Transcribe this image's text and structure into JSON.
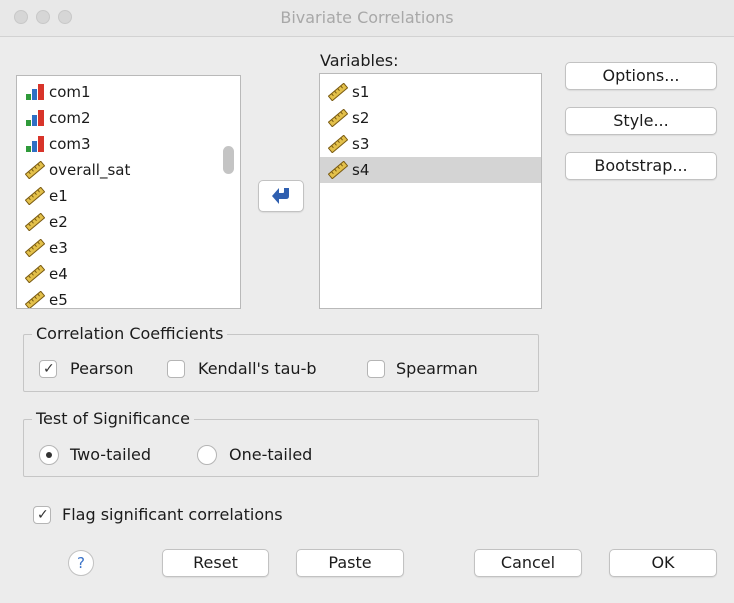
{
  "window": {
    "title": "Bivariate Correlations"
  },
  "source_list": {
    "items": [
      {
        "label": "com1",
        "icon": "nominal-bar-icon"
      },
      {
        "label": "com2",
        "icon": "nominal-bar-icon"
      },
      {
        "label": "com3",
        "icon": "nominal-bar-icon"
      },
      {
        "label": "overall_sat",
        "icon": "scale-ruler-icon"
      },
      {
        "label": "e1",
        "icon": "scale-ruler-icon"
      },
      {
        "label": "e2",
        "icon": "scale-ruler-icon"
      },
      {
        "label": "e3",
        "icon": "scale-ruler-icon"
      },
      {
        "label": "e4",
        "icon": "scale-ruler-icon"
      },
      {
        "label": "e5",
        "icon": "scale-ruler-icon"
      }
    ]
  },
  "move_button": {
    "icon": "arrow-left-icon"
  },
  "variables": {
    "label": "Variables:",
    "items": [
      {
        "label": "s1",
        "icon": "scale-ruler-icon",
        "selected": false
      },
      {
        "label": "s2",
        "icon": "scale-ruler-icon",
        "selected": false
      },
      {
        "label": "s3",
        "icon": "scale-ruler-icon",
        "selected": false
      },
      {
        "label": "s4",
        "icon": "scale-ruler-icon",
        "selected": true
      }
    ]
  },
  "side_buttons": {
    "options": "Options...",
    "style": "Style...",
    "bootstrap": "Bootstrap..."
  },
  "coefficients": {
    "legend": "Correlation Coefficients",
    "pearson": {
      "label": "Pearson",
      "checked": true
    },
    "kendall": {
      "label": "Kendall's tau-b",
      "checked": false
    },
    "spearman": {
      "label": "Spearman",
      "checked": false
    }
  },
  "significance": {
    "legend": "Test of Significance",
    "two_tailed": {
      "label": "Two-tailed",
      "selected": true
    },
    "one_tailed": {
      "label": "One-tailed",
      "selected": false
    }
  },
  "flag": {
    "label": "Flag significant correlations",
    "checked": true
  },
  "footer": {
    "help": "?",
    "reset": "Reset",
    "paste": "Paste",
    "cancel": "Cancel",
    "ok": "OK"
  },
  "colors": {
    "selected_row": "#d4d4d4",
    "arrow": "#2f5fb0",
    "help_text": "#3b73c8"
  }
}
